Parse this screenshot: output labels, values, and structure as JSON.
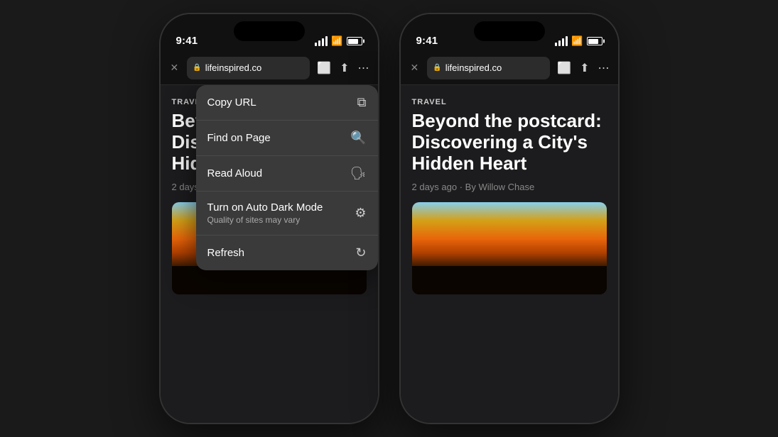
{
  "phones": {
    "left": {
      "time": "9:41",
      "url": "lifeinspired.co",
      "content": {
        "label": "TRAVEL",
        "title": "Beyond the postcard: Discovering a City's Hidden Heart",
        "meta": "2 days ago"
      },
      "menu": {
        "items": [
          {
            "id": "copy-url",
            "title": "Copy URL",
            "subtitle": "",
            "icon": "⧉"
          },
          {
            "id": "find-on-page",
            "title": "Find on Page",
            "subtitle": "",
            "icon": "🔍"
          },
          {
            "id": "read-aloud",
            "title": "Read Aloud",
            "subtitle": "",
            "icon": "👤"
          },
          {
            "id": "auto-dark",
            "title": "Turn on Auto Dark Mode",
            "subtitle": "Quality of sites may vary",
            "icon": "⚙"
          },
          {
            "id": "refresh",
            "title": "Refresh",
            "subtitle": "",
            "icon": "↻"
          }
        ]
      }
    },
    "right": {
      "time": "9:41",
      "url": "lifeinspired.co",
      "content": {
        "label": "TRAVEL",
        "title": "Beyond the postcard: Discovering a City's Hidden Heart",
        "meta": "2 days ago · By Willow Chase"
      }
    }
  }
}
